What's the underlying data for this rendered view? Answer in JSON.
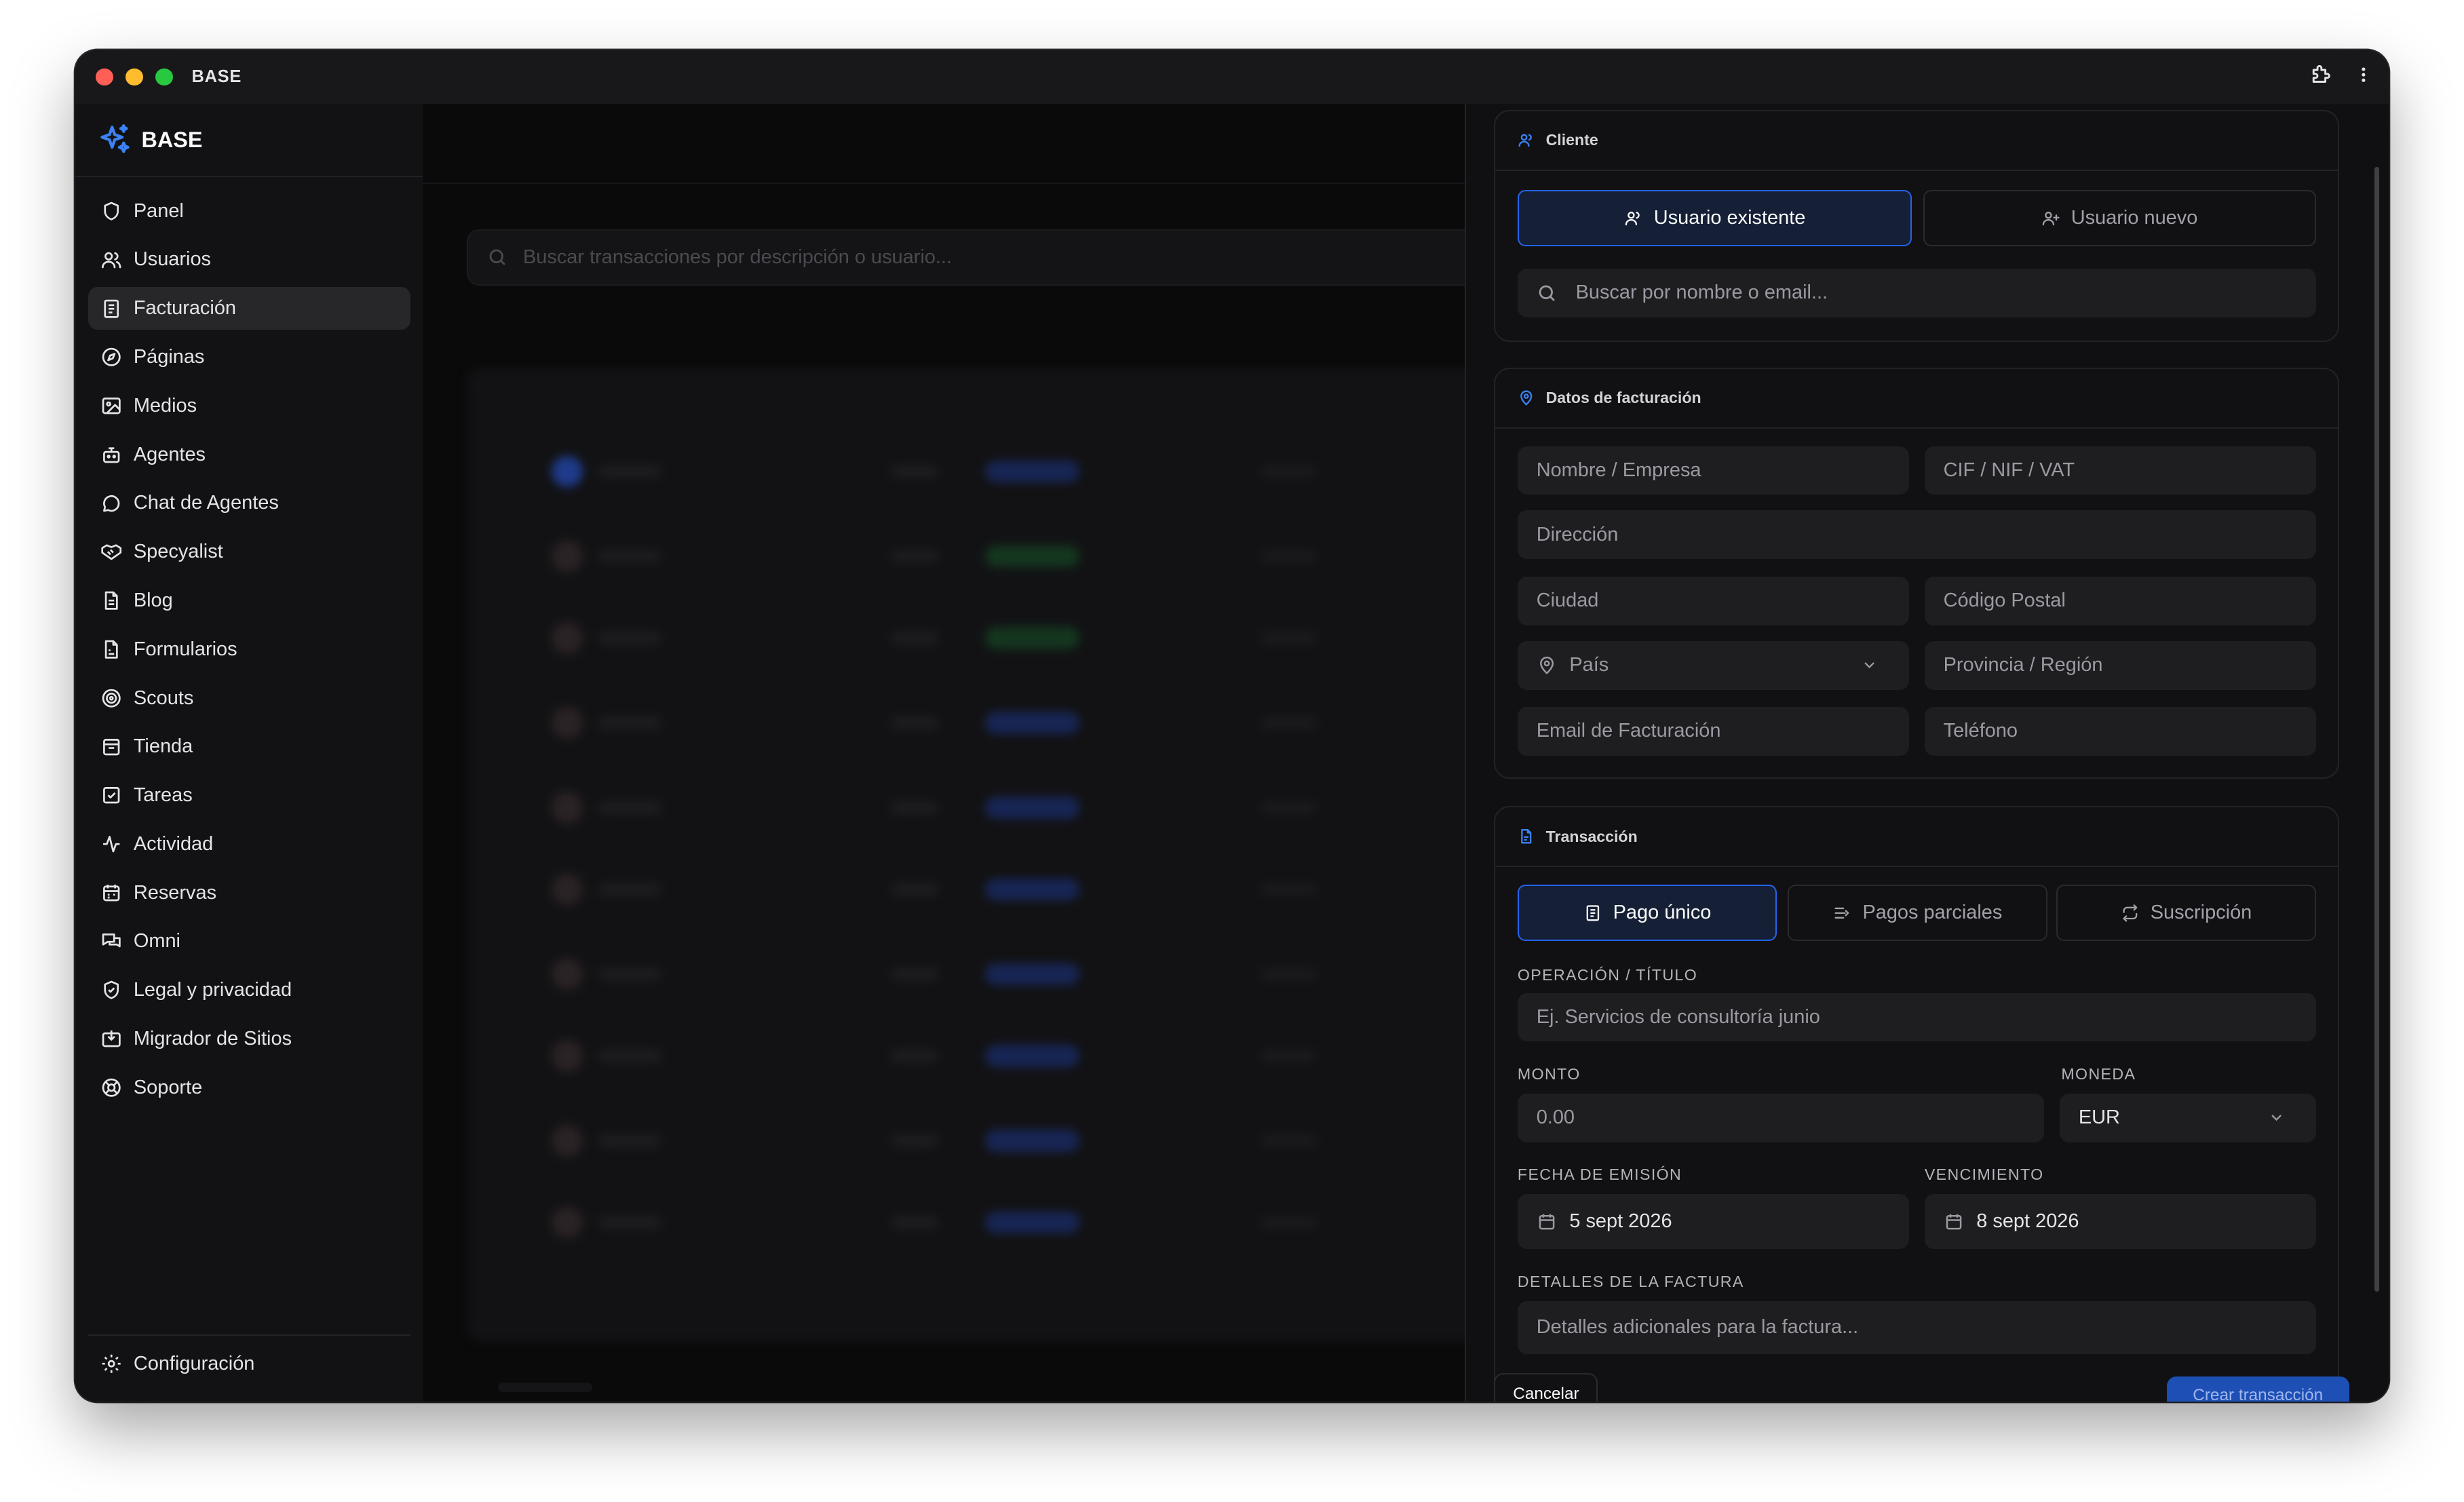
{
  "window": {
    "app_title": "BASE"
  },
  "sidebar": {
    "brand": "BASE",
    "items": [
      {
        "label": "Panel",
        "icon": "shield-icon"
      },
      {
        "label": "Usuarios",
        "icon": "users-icon"
      },
      {
        "label": "Facturación",
        "icon": "invoice-icon"
      },
      {
        "label": "Páginas",
        "icon": "compass-icon"
      },
      {
        "label": "Medios",
        "icon": "image-icon"
      },
      {
        "label": "Agentes",
        "icon": "bot-icon"
      },
      {
        "label": "Chat de Agentes",
        "icon": "message-circle-icon"
      },
      {
        "label": "Specyalist",
        "icon": "handshake-icon"
      },
      {
        "label": "Blog",
        "icon": "file-text-icon"
      },
      {
        "label": "Formularios",
        "icon": "form-file-icon"
      },
      {
        "label": "Scouts",
        "icon": "radar-icon"
      },
      {
        "label": "Tienda",
        "icon": "store-icon"
      },
      {
        "label": "Tareas",
        "icon": "checkbox-icon"
      },
      {
        "label": "Actividad",
        "icon": "activity-icon"
      },
      {
        "label": "Reservas",
        "icon": "calendar-grid-icon"
      },
      {
        "label": "Omni",
        "icon": "chat-bubbles-icon"
      },
      {
        "label": "Legal y privacidad",
        "icon": "shield-check-icon"
      },
      {
        "label": "Migrador de Sitios",
        "icon": "import-icon"
      },
      {
        "label": "Soporte",
        "icon": "lifebuoy-icon"
      }
    ],
    "active_index": 2,
    "footer": {
      "label": "Configuración",
      "icon": "gear-icon"
    }
  },
  "main": {
    "search_placeholder": "Buscar transacciones por descripción o usuario..."
  },
  "panel": {
    "cliente": {
      "title": "Cliente",
      "tab_existing": "Usuario existente",
      "tab_new": "Usuario nuevo",
      "search_placeholder": "Buscar por nombre o email..."
    },
    "billing": {
      "title": "Datos de facturación",
      "name": "Nombre / Empresa",
      "tax_id": "CIF / NIF / VAT",
      "address": "Dirección",
      "city": "Ciudad",
      "postal": "Código Postal",
      "country": "País",
      "region": "Provincia / Región",
      "email": "Email de Facturación",
      "phone": "Teléfono"
    },
    "transaction": {
      "title": "Transacción",
      "tab_single": "Pago único",
      "tab_partial": "Pagos parciales",
      "tab_subscription": "Suscripción",
      "op_label": "OPERACIÓN / TÍTULO",
      "op_placeholder": "Ej. Servicios de consultoría junio",
      "amount_label": "MONTO",
      "amount_placeholder": "0.00",
      "currency_label": "MONEDA",
      "currency_value": "EUR",
      "issue_label": "FECHA DE EMISIÓN",
      "issue_value": "5 sept 2026",
      "due_label": "VENCIMIENTO",
      "due_value": "8 sept 2026",
      "details_label": "DETALLES DE LA FACTURA",
      "details_placeholder": "Detalles adicionales para la factura..."
    },
    "actions": {
      "cancel": "Cancelar",
      "create": "Crear transacción"
    }
  },
  "colors": {
    "accent": "#2563eb",
    "traffic_red": "#ff5f57",
    "traffic_yellow": "#febc2e",
    "traffic_green": "#28c840"
  }
}
